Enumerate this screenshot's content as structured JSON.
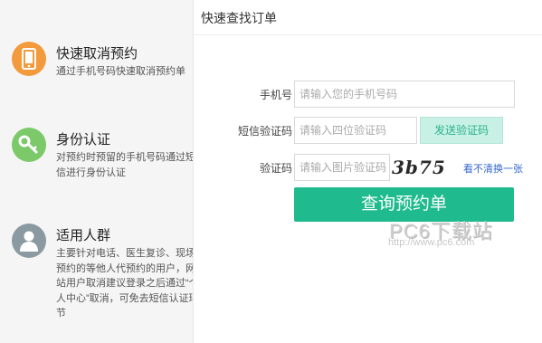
{
  "sidebar": {
    "features": [
      {
        "title": "快速取消预约",
        "desc": "通过手机号码快速取消预约单",
        "icon": "phone-icon",
        "color": "#f39a3c"
      },
      {
        "title": "身份认证",
        "desc": "对预约时预留的手机号码通过短信进行身份认证",
        "icon": "key-icon",
        "color": "#7cc96a"
      },
      {
        "title": "适用人群",
        "desc": "主要针对电话、医生复诊、现场预约的等他人代预约的用户，网站用户取消建议登录之后通过“个人中心”取消，可免去短信认证环节",
        "icon": "person-icon",
        "color": "#8a9aa0"
      }
    ]
  },
  "main": {
    "title": "快速查找订单",
    "form": {
      "phone_label": "手机号",
      "phone_placeholder": "请输入您的手机号码",
      "sms_label": "短信验证码",
      "sms_placeholder": "请输入四位验证码",
      "sms_button": "发送验证码",
      "captcha_label": "验证码",
      "captcha_placeholder": "请输入图片验证码",
      "captcha_image_text": "3b75",
      "refresh_link": "看不清换一张",
      "submit_label": "查询预约单"
    }
  },
  "watermark": {
    "name": "PC6下载站",
    "url": "http://www.pc6.com"
  },
  "colors": {
    "accent": "#1fbb8e",
    "sms_button_bg": "#c8f0e4",
    "sidebar_bg": "#f5f5f5",
    "link": "#3366cc"
  }
}
